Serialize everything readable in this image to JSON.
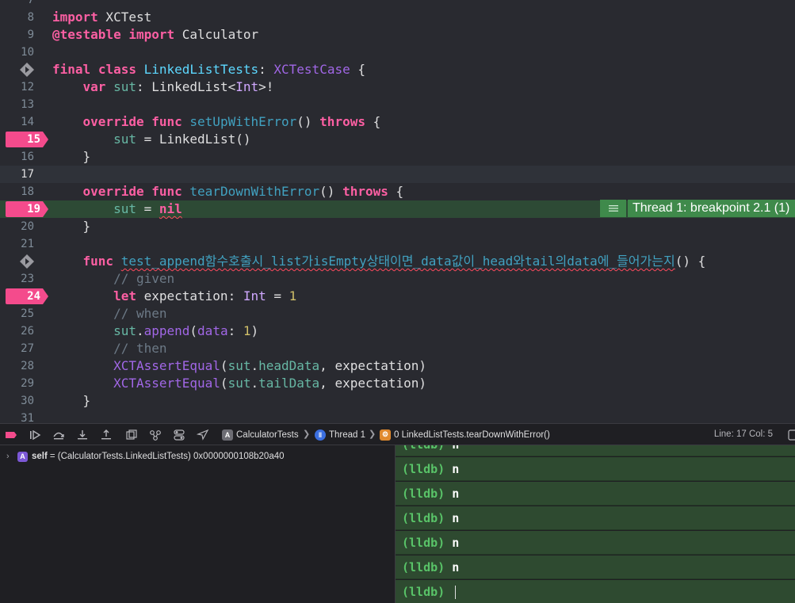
{
  "editor": {
    "lines": [
      {
        "num": "7",
        "tokens": []
      },
      {
        "num": "8",
        "tokens": [
          [
            "kw",
            "import"
          ],
          [
            "p",
            " XCTest"
          ]
        ]
      },
      {
        "num": "9",
        "tokens": [
          [
            "kw",
            "@testable"
          ],
          [
            "p",
            " "
          ],
          [
            "kw",
            "import"
          ],
          [
            "p",
            " Calculator"
          ]
        ]
      },
      {
        "num": "10",
        "tokens": []
      },
      {
        "num": "11",
        "tokens": [
          [
            "kw",
            "final"
          ],
          [
            "p",
            " "
          ],
          [
            "kw",
            "class"
          ],
          [
            "p",
            " "
          ],
          [
            "cls",
            "LinkedListTests"
          ],
          [
            "p",
            ": "
          ],
          [
            "pjt",
            "XCTestCase"
          ],
          [
            "p",
            " {"
          ]
        ]
      },
      {
        "num": "12",
        "tokens": [
          [
            "p",
            "    "
          ],
          [
            "kw",
            "var"
          ],
          [
            "p",
            " "
          ],
          [
            "prj",
            "sut"
          ],
          [
            "p",
            ": "
          ],
          [
            "p",
            "LinkedList"
          ],
          [
            "p",
            "<"
          ],
          [
            "typ",
            "Int"
          ],
          [
            "p",
            ">!"
          ]
        ]
      },
      {
        "num": "13",
        "tokens": []
      },
      {
        "num": "14",
        "tokens": [
          [
            "p",
            "    "
          ],
          [
            "kw",
            "override"
          ],
          [
            "p",
            " "
          ],
          [
            "kw",
            "func"
          ],
          [
            "p",
            " "
          ],
          [
            "fn",
            "setUpWithError"
          ],
          [
            "p",
            "() "
          ],
          [
            "kw",
            "throws"
          ],
          [
            "p",
            " {"
          ]
        ]
      },
      {
        "num": "15",
        "tokens": [
          [
            "p",
            "        "
          ],
          [
            "prj",
            "sut"
          ],
          [
            "p",
            " = "
          ],
          [
            "p",
            "LinkedList"
          ],
          [
            "p",
            "()"
          ]
        ]
      },
      {
        "num": "16",
        "tokens": [
          [
            "p",
            "    }"
          ]
        ]
      },
      {
        "num": "17",
        "tokens": []
      },
      {
        "num": "18",
        "tokens": [
          [
            "p",
            "    "
          ],
          [
            "kw",
            "override"
          ],
          [
            "p",
            " "
          ],
          [
            "kw",
            "func"
          ],
          [
            "p",
            " "
          ],
          [
            "fn",
            "tearDownWithError"
          ],
          [
            "p",
            "() "
          ],
          [
            "kw",
            "throws"
          ],
          [
            "p",
            " {"
          ]
        ]
      },
      {
        "num": "19",
        "tokens": [
          [
            "p",
            "        "
          ],
          [
            "prj",
            "sut"
          ],
          [
            "p",
            " = "
          ],
          [
            "kwsq",
            "nil"
          ]
        ]
      },
      {
        "num": "20",
        "tokens": [
          [
            "p",
            "    }"
          ]
        ]
      },
      {
        "num": "21",
        "tokens": []
      },
      {
        "num": "22",
        "tokens": [
          [
            "p",
            "    "
          ],
          [
            "kw",
            "func"
          ],
          [
            "p",
            " "
          ],
          [
            "fnsq",
            "test_append함수호출시_list가isEmpty상태이면_data값이_head와tail의data에_들어가는지"
          ],
          [
            "p",
            "() {"
          ]
        ]
      },
      {
        "num": "23",
        "tokens": [
          [
            "p",
            "        "
          ],
          [
            "cmt",
            "// given"
          ]
        ]
      },
      {
        "num": "24",
        "tokens": [
          [
            "p",
            "        "
          ],
          [
            "kw",
            "let"
          ],
          [
            "p",
            " expectation: "
          ],
          [
            "typ",
            "Int"
          ],
          [
            "p",
            " = "
          ],
          [
            "num",
            "1"
          ]
        ]
      },
      {
        "num": "25",
        "tokens": [
          [
            "p",
            "        "
          ],
          [
            "cmt",
            "// when"
          ]
        ]
      },
      {
        "num": "26",
        "tokens": [
          [
            "p",
            "        "
          ],
          [
            "prj",
            "sut"
          ],
          [
            "p",
            "."
          ],
          [
            "pjt",
            "append"
          ],
          [
            "p",
            "("
          ],
          [
            "pjt",
            "data"
          ],
          [
            "p",
            ": "
          ],
          [
            "num",
            "1"
          ],
          [
            "p",
            ")"
          ]
        ]
      },
      {
        "num": "27",
        "tokens": [
          [
            "p",
            "        "
          ],
          [
            "cmt",
            "// then"
          ]
        ]
      },
      {
        "num": "28",
        "tokens": [
          [
            "p",
            "        "
          ],
          [
            "pjt",
            "XCTAssertEqual"
          ],
          [
            "p",
            "("
          ],
          [
            "prj",
            "sut"
          ],
          [
            "p",
            "."
          ],
          [
            "prj",
            "headData"
          ],
          [
            "p",
            ", expectation)"
          ]
        ]
      },
      {
        "num": "29",
        "tokens": [
          [
            "p",
            "        "
          ],
          [
            "pjt",
            "XCTAssertEqual"
          ],
          [
            "p",
            "("
          ],
          [
            "prj",
            "sut"
          ],
          [
            "p",
            "."
          ],
          [
            "prj",
            "tailData"
          ],
          [
            "p",
            ", expectation)"
          ]
        ]
      },
      {
        "num": "30",
        "tokens": [
          [
            "p",
            "    }"
          ]
        ]
      },
      {
        "num": "31",
        "tokens": []
      }
    ],
    "breakpoints": [
      "15",
      "19",
      "24"
    ],
    "test_diamonds": [
      "11",
      "22"
    ],
    "current_line": "17",
    "highlight_line": "19",
    "thread_badge": "Thread 1: breakpoint 2.1 (1)"
  },
  "debugbar": {
    "crumbs": [
      "CalculatorTests",
      "Thread 1",
      "0 LinkedListTests.tearDownWithError()"
    ],
    "linecol": "Line: 17  Col: 5"
  },
  "variables": {
    "name": "self",
    "value": "= (CalculatorTests.LinkedListTests) 0x0000000108b20a40"
  },
  "console": {
    "prompt": "(lldb)",
    "partial_top": "(lldb) n",
    "commands": [
      "n",
      "n",
      "n",
      "n",
      "n"
    ],
    "input": ""
  },
  "colors": {
    "breakpoint": "#f44b8c",
    "highlight": "#2d4a35",
    "badge": "#3f8a4b"
  }
}
